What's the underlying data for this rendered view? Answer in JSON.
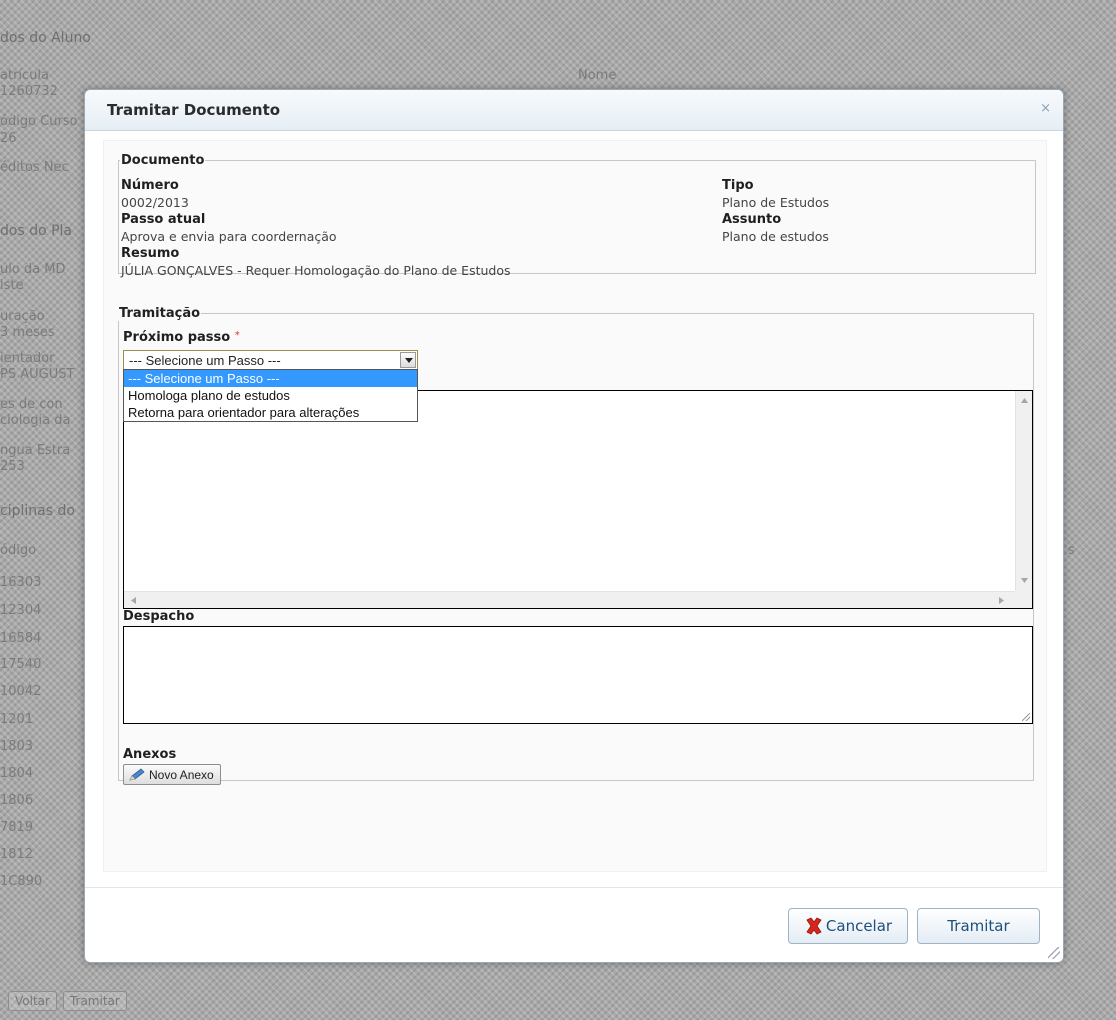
{
  "background": {
    "section_aluno": "dos do Aluno",
    "matricula_label": "atrícula",
    "matricula_value": "1260732",
    "nome_label": "Nome",
    "codigo_curso_label": "ódigo Curso",
    "codigo_curso_value": "26",
    "creditos_label": "éditos Nec",
    "section_plano": "dos do Pla",
    "titulo_label": "ulo da MD",
    "titulo_value": "iste",
    "duracao_label": "uração",
    "duracao_value": "3 meses",
    "orientador_label": "ientador",
    "orientador_value": "PS AUGUST",
    "coorientador_label": "es de con",
    "coorientador_value": "ciologia da",
    "lingua_label": "ngua Estra",
    "lingua_value": "253",
    "disciplinas_label": "ciplinas do",
    "codigo_header": "ódigo",
    "right_header": "s",
    "codes": [
      "16303",
      "12304",
      "16584",
      "17540",
      "10042",
      "1201",
      "1803",
      "1804",
      "1806",
      "7819",
      "1812",
      "1C890"
    ],
    "voltar_label": "Voltar",
    "tramitar_label": "Tramitar"
  },
  "dialog": {
    "title": "Tramitar Documento",
    "close_glyph": "×",
    "documento": {
      "legend": "Documento",
      "numero_label": "Número",
      "numero_value": "0002/2013",
      "passo_label": "Passo atual",
      "passo_value": "Aprova e envia para coordernação",
      "resumo_label": "Resumo",
      "resumo_value": "JÚLIA GONÇALVES - Requer Homologação do Plano de Estudos",
      "tipo_label": "Tipo",
      "tipo_value": "Plano de Estudos",
      "assunto_label": "Assunto",
      "assunto_value": "Plano de estudos"
    },
    "tramitacao": {
      "legend": "Tramitação",
      "proximo_label": "Próximo passo",
      "required_mark": "*",
      "select_value": "--- Selecione um Passo ---",
      "options": [
        "--- Selecione um Passo ---",
        "Homologa plano de estudos",
        "Retorna para orientador para alterações"
      ],
      "despacho_label": "Despacho",
      "anexos_label": "Anexos",
      "novo_anexo_label": "Novo Anexo"
    },
    "buttons": {
      "cancel_label": "Cancelar",
      "submit_label": "Tramitar"
    }
  },
  "colors": {
    "accent": "#1f4f7a",
    "option_highlight": "#3399ff",
    "cancel_icon": "#d9261c"
  }
}
